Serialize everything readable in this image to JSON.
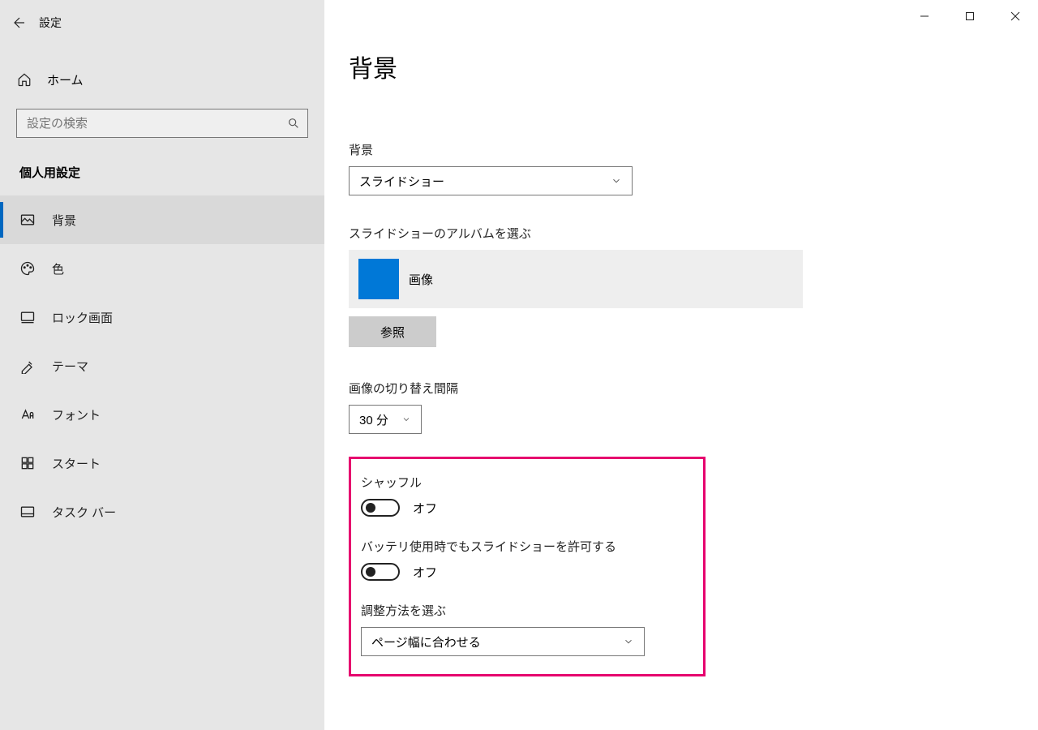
{
  "app_title": "設定",
  "sidebar": {
    "home_label": "ホーム",
    "search_placeholder": "設定の検索",
    "category": "個人用設定",
    "items": [
      {
        "label": "背景"
      },
      {
        "label": "色"
      },
      {
        "label": "ロック画面"
      },
      {
        "label": "テーマ"
      },
      {
        "label": "フォント"
      },
      {
        "label": "スタート"
      },
      {
        "label": "タスク バー"
      }
    ]
  },
  "page": {
    "title": "背景",
    "background_label": "背景",
    "background_value": "スライドショー",
    "album_label": "スライドショーのアルバムを選ぶ",
    "album_name": "画像",
    "browse_label": "参照",
    "interval_label": "画像の切り替え間隔",
    "interval_value": "30 分",
    "shuffle_label": "シャッフル",
    "shuffle_state": "オフ",
    "battery_label": "バッテリ使用時でもスライドショーを許可する",
    "battery_state": "オフ",
    "fit_label": "調整方法を選ぶ",
    "fit_value": "ページ幅に合わせる"
  }
}
